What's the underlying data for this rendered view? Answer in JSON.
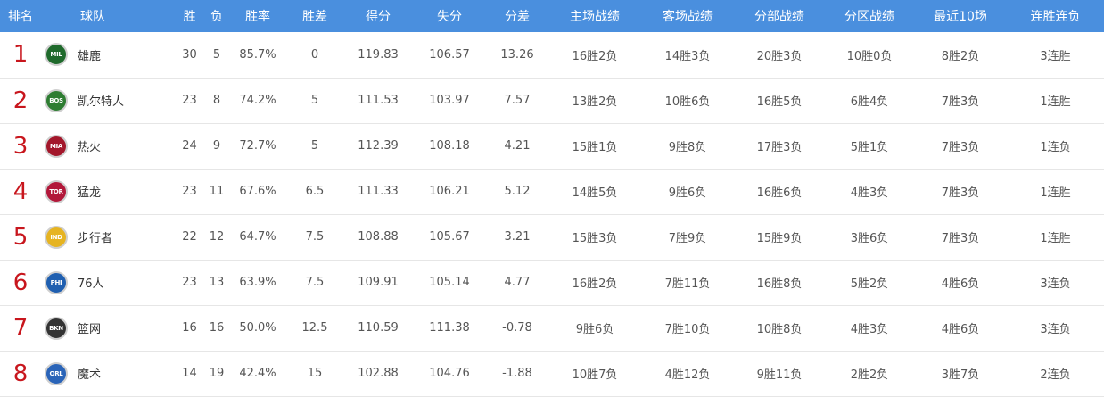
{
  "headers": {
    "rank": "排名",
    "team": "球队",
    "wins": "胜",
    "losses": "负",
    "pct": "胜率",
    "gb": "胜差",
    "pts_for": "得分",
    "pts_against": "失分",
    "diff": "分差",
    "home": "主场战绩",
    "away": "客场战绩",
    "div": "分部战绩",
    "conf": "分区战绩",
    "last10": "最近10场",
    "streak": "连胜连负"
  },
  "rows": [
    {
      "rank": "1",
      "logo": "MIL",
      "logo_color": "#1f6a2c",
      "team": "雄鹿",
      "wins": "30",
      "losses": "5",
      "pct": "85.7%",
      "gb": "0",
      "pts_for": "119.83",
      "pts_against": "106.57",
      "diff": "13.26",
      "home": "16胜2负",
      "away": "14胜3负",
      "div": "20胜3负",
      "conf": "10胜0负",
      "last10": "8胜2负",
      "streak": "3连胜"
    },
    {
      "rank": "2",
      "logo": "BOS",
      "logo_color": "#2e7d32",
      "team": "凯尔特人",
      "wins": "23",
      "losses": "8",
      "pct": "74.2%",
      "gb": "5",
      "pts_for": "111.53",
      "pts_against": "103.97",
      "diff": "7.57",
      "home": "13胜2负",
      "away": "10胜6负",
      "div": "16胜5负",
      "conf": "6胜4负",
      "last10": "7胜3负",
      "streak": "1连胜"
    },
    {
      "rank": "3",
      "logo": "MIA",
      "logo_color": "#a3172b",
      "team": "热火",
      "wins": "24",
      "losses": "9",
      "pct": "72.7%",
      "gb": "5",
      "pts_for": "112.39",
      "pts_against": "108.18",
      "diff": "4.21",
      "home": "15胜1负",
      "away": "9胜8负",
      "div": "17胜3负",
      "conf": "5胜1负",
      "last10": "7胜3负",
      "streak": "1连负"
    },
    {
      "rank": "4",
      "logo": "TOR",
      "logo_color": "#b2183a",
      "team": "猛龙",
      "wins": "23",
      "losses": "11",
      "pct": "67.6%",
      "gb": "6.5",
      "pts_for": "111.33",
      "pts_against": "106.21",
      "diff": "5.12",
      "home": "14胜5负",
      "away": "9胜6负",
      "div": "16胜6负",
      "conf": "4胜3负",
      "last10": "7胜3负",
      "streak": "1连胜"
    },
    {
      "rank": "5",
      "logo": "IND",
      "logo_color": "#e6b422",
      "team": "步行者",
      "wins": "22",
      "losses": "12",
      "pct": "64.7%",
      "gb": "7.5",
      "pts_for": "108.88",
      "pts_against": "105.67",
      "diff": "3.21",
      "home": "15胜3负",
      "away": "7胜9负",
      "div": "15胜9负",
      "conf": "3胜6负",
      "last10": "7胜3负",
      "streak": "1连胜"
    },
    {
      "rank": "6",
      "logo": "PHI",
      "logo_color": "#1f5fb0",
      "team": "76人",
      "wins": "23",
      "losses": "13",
      "pct": "63.9%",
      "gb": "7.5",
      "pts_for": "109.91",
      "pts_against": "105.14",
      "diff": "4.77",
      "home": "16胜2负",
      "away": "7胜11负",
      "div": "16胜8负",
      "conf": "5胜2负",
      "last10": "4胜6负",
      "streak": "3连负"
    },
    {
      "rank": "7",
      "logo": "BKN",
      "logo_color": "#333333",
      "team": "篮网",
      "wins": "16",
      "losses": "16",
      "pct": "50.0%",
      "gb": "12.5",
      "pts_for": "110.59",
      "pts_against": "111.38",
      "diff": "-0.78",
      "home": "9胜6负",
      "away": "7胜10负",
      "div": "10胜8负",
      "conf": "4胜3负",
      "last10": "4胜6负",
      "streak": "3连负"
    },
    {
      "rank": "8",
      "logo": "ORL",
      "logo_color": "#2a64b8",
      "team": "魔术",
      "wins": "14",
      "losses": "19",
      "pct": "42.4%",
      "gb": "15",
      "pts_for": "102.88",
      "pts_against": "104.76",
      "diff": "-1.88",
      "home": "10胜7负",
      "away": "4胜12负",
      "div": "9胜11负",
      "conf": "2胜2负",
      "last10": "3胜7负",
      "streak": "2连负"
    }
  ]
}
